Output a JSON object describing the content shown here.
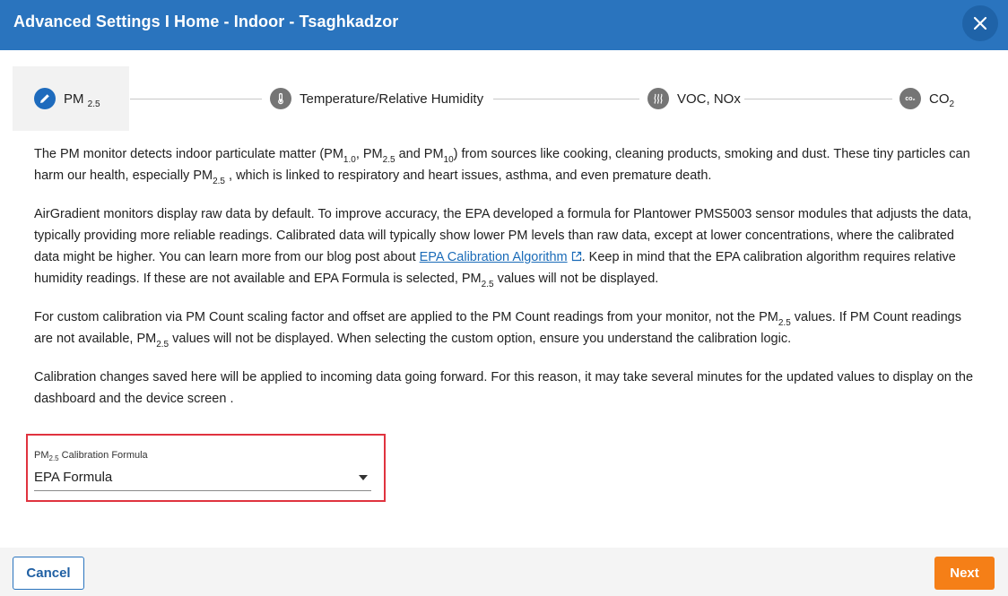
{
  "header": {
    "title": "Advanced Settings I Home - Indoor - Tsaghkadzor",
    "close_icon": "close-icon",
    "bg_color": "#2a74be"
  },
  "stepper": {
    "steps": [
      {
        "label": "PM",
        "sub": "2.5",
        "icon": "pencil-icon",
        "active": true
      },
      {
        "label": "Temperature/Relative Humidity",
        "sub": "",
        "icon": "thermometer-icon",
        "active": false
      },
      {
        "label": "VOC, NOx",
        "sub": "",
        "icon": "waves-icon",
        "active": false
      },
      {
        "label": "CO",
        "sub": "2",
        "icon": "co2-icon",
        "icon_text": "co₂",
        "active": false
      }
    ]
  },
  "content": {
    "p1": {
      "a": "The PM monitor detects indoor particulate matter (PM",
      "sub1": "1.0",
      "b": ", PM",
      "sub2": "2.5",
      "c": " and PM",
      "sub3": "10",
      "d": ") from sources like cooking, cleaning products, smoking and dust. These tiny particles can harm our health, especially PM",
      "sub4": "2.5",
      "e": " , which is linked to respiratory and heart issues, asthma, and even premature death."
    },
    "p2": {
      "a": "AirGradient monitors display raw data by default. To improve accuracy, the EPA developed a formula for Plantower PMS5003 sensor modules that adjusts the data, typically providing more reliable readings. Calibrated data will typically show lower PM levels than raw data, except at lower concentrations, where the calibrated data might be higher. You can learn more from our blog post about ",
      "link": "EPA Calibration Algorithm",
      "b": ". Keep in mind that the EPA calibration algorithm requires relative humidity readings. If these are not available and EPA Formula is selected, PM",
      "sub1": "2.5",
      "c": " values will not be displayed."
    },
    "p3": {
      "a": "For custom calibration via PM Count scaling factor and offset are applied to the PM Count readings from your monitor, not the PM",
      "sub1": "2.5",
      "b": " values. If PM Count readings are not available, PM",
      "sub2": "2.5",
      "c": " values will not be displayed. When selecting the custom option, ensure you understand the calibration logic."
    },
    "p4": "Calibration changes saved here will be applied to incoming data going forward. For this reason, it may take several minutes for the updated values to display on the dashboard and the device screen ."
  },
  "calibration_select": {
    "label_pre": "PM",
    "label_sub": "2.5",
    "label_post": " Calibration Formula",
    "value": "EPA Formula",
    "highlight_color": "#e0333f"
  },
  "footer": {
    "cancel_label": "Cancel",
    "next_label": "Next",
    "next_color": "#f57f17"
  }
}
